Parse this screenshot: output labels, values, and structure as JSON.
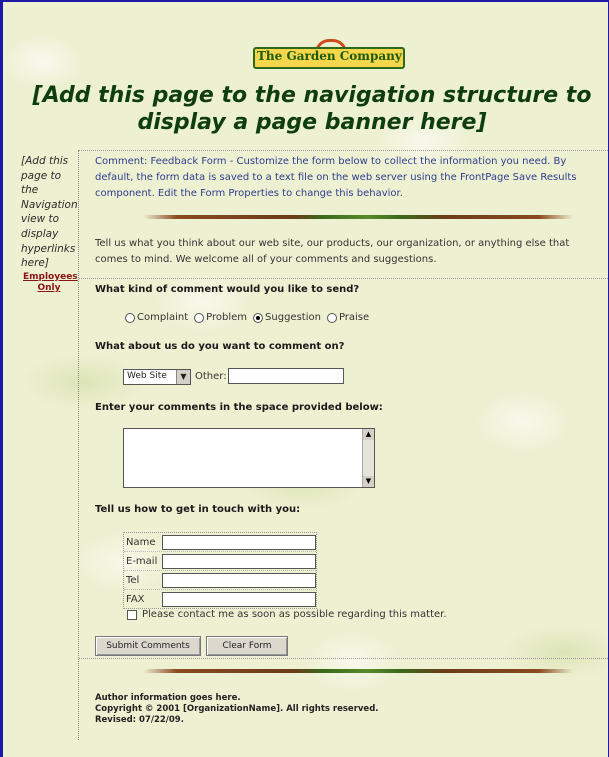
{
  "logo": {
    "text": "The Garden Company"
  },
  "banner": {
    "text": "[Add this page to the navigation structure to display a page banner here]"
  },
  "leftnav": {
    "placeholder": "[Add this page to the Navigation view to display hyperlinks here]",
    "employees_link": "Employees Only"
  },
  "comment": {
    "text": "Comment: Feedback Form - Customize the form below to collect the information you need. By default, the form data is saved to a text file on the web server using the FrontPage Save Results component. Edit the Form Properties to change this behavior."
  },
  "intro": {
    "text": "Tell us what you think about our web site, our products, our organization, or anything else that comes to mind. We welcome all of your comments and suggestions."
  },
  "q1": {
    "label": "What kind of comment would you like to send?",
    "options": [
      "Complaint",
      "Problem",
      "Suggestion",
      "Praise"
    ],
    "selected": "Suggestion"
  },
  "q2": {
    "label": "What about us do you want to comment on?",
    "select_value": "Web Site",
    "other_label": "Other:",
    "other_value": ""
  },
  "q3": {
    "label": "Enter your comments in the space provided below:",
    "value": ""
  },
  "contact": {
    "label": "Tell us how to get in touch with you:",
    "fields": [
      "Name",
      "E-mail",
      "Tel",
      "FAX"
    ],
    "checkbox_label": "Please contact me as soon as possible regarding this matter."
  },
  "buttons": {
    "submit": "Submit Comments",
    "clear": "Clear Form"
  },
  "footer": {
    "author": "Author information goes here.",
    "copyright": "Copyright © 2001 [OrganizationName]. All rights reserved.",
    "revised": "Revised: 07/22/09."
  }
}
